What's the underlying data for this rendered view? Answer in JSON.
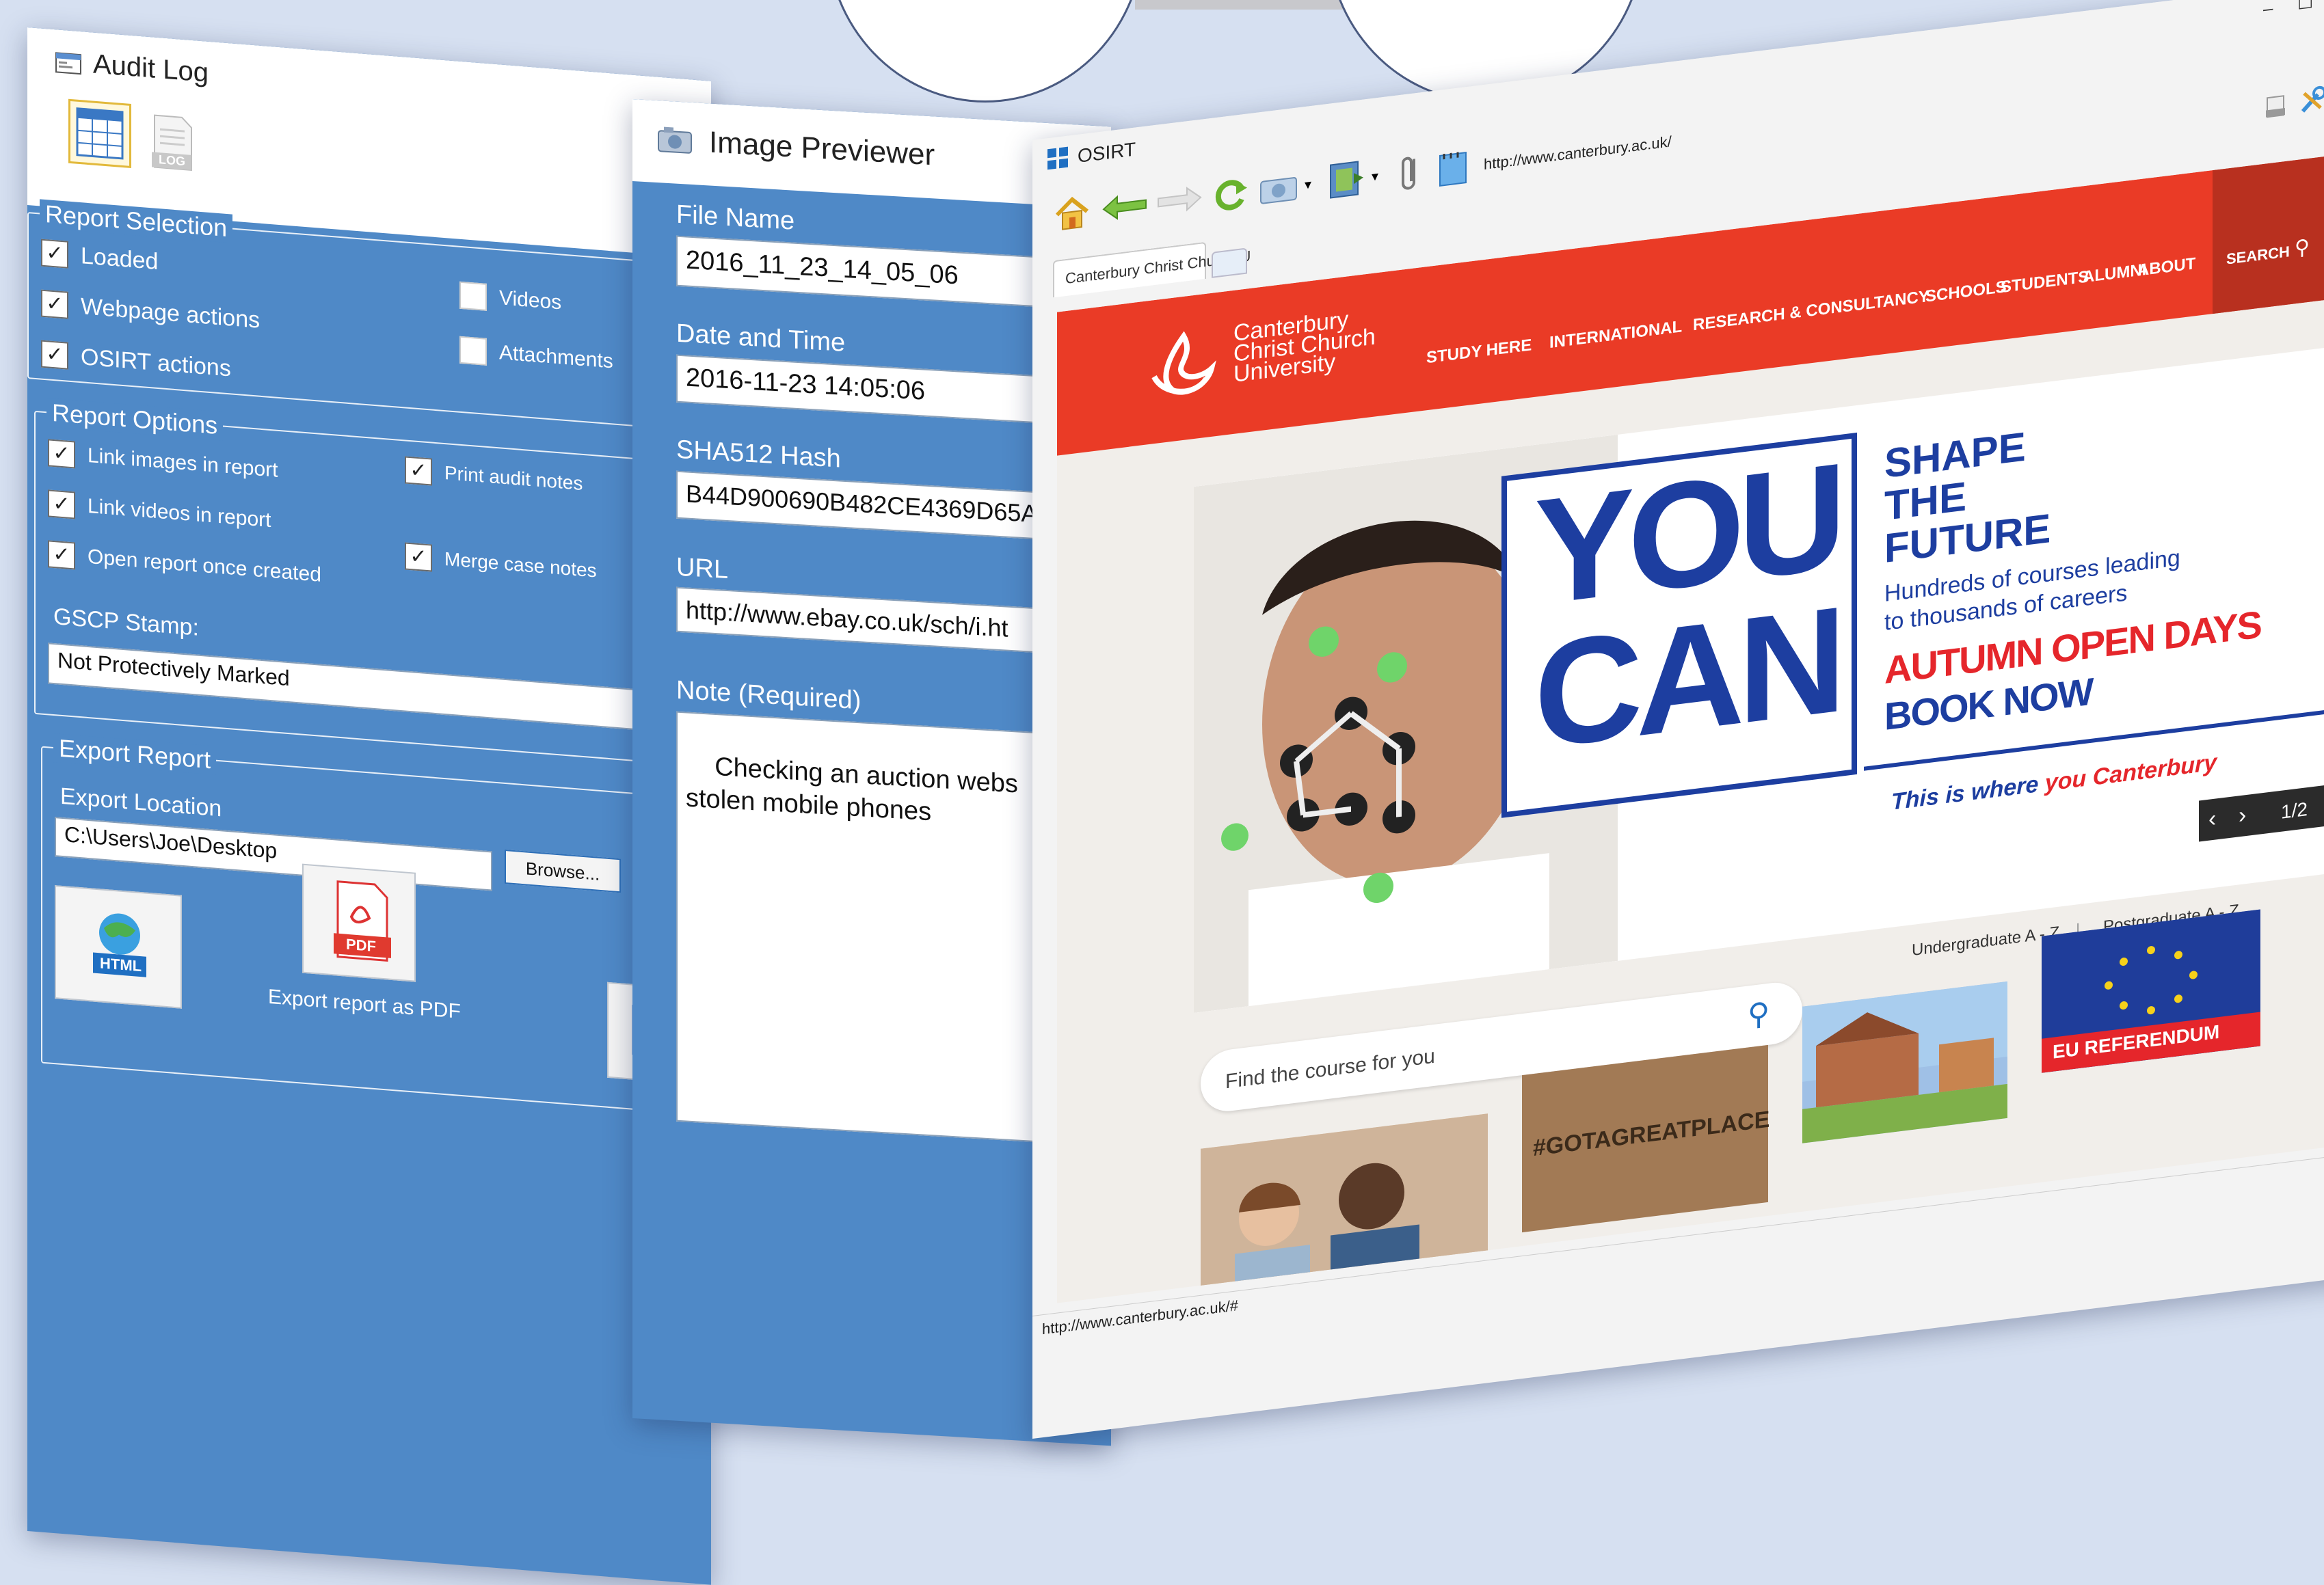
{
  "audit_log": {
    "title": "Audit Log",
    "log_icon_label": "LOG",
    "report_selection": {
      "legend": "Report Selection",
      "items": [
        {
          "label": "Loaded",
          "checked": true
        },
        {
          "label": "Webpage actions",
          "checked": true
        },
        {
          "label": "OSIRT actions",
          "checked": true
        },
        {
          "label": "Videos",
          "checked": false
        },
        {
          "label": "Attachments",
          "checked": false
        }
      ]
    },
    "report_options": {
      "legend": "Report Options",
      "items": [
        {
          "label": "Link images in report",
          "checked": true
        },
        {
          "label": "Link videos in report",
          "checked": true
        },
        {
          "label": "Open report once created",
          "checked": true
        },
        {
          "label": "Print audit notes",
          "checked": true
        },
        {
          "label": "Merge case notes",
          "checked": true
        }
      ],
      "gscp_label": "GSCP Stamp:",
      "gscp_value": "Not Protectively Marked"
    },
    "export_report": {
      "legend": "Export Report",
      "location_label": "Export Location",
      "location_value": "C:\\Users\\Joe\\Desktop",
      "browse_label": "Browse...",
      "html_badge": "HTML",
      "pdf_badge": "PDF",
      "pdf_caption": "Export report as PDF"
    }
  },
  "image_previewer": {
    "title": "Image Previewer",
    "file_name_label": "File Name",
    "file_name_value": "2016_11_23_14_05_06",
    "date_label": "Date and Time",
    "date_value": "2016-11-23 14:05:06",
    "hash_label": "SHA512 Hash",
    "hash_value": "B44D900690B482CE4369D65A",
    "url_label": "URL",
    "url_value": "http://www.ebay.co.uk/sch/i.ht",
    "note_label": "Note (Required)",
    "note_value": "Checking an auction webs\nstolen mobile phones"
  },
  "osirt": {
    "title": "OSIRT",
    "address": "http://www.canterbury.ac.uk/",
    "tab_label": "Canterbury Christ Church U",
    "status_url": "http://www.canterbury.ac.uk/#",
    "log_label": "LOG",
    "site": {
      "logo_lines": [
        "Canterbury",
        "Christ Church",
        "University"
      ],
      "nav": [
        "STUDY HERE",
        "INTERNATIONAL",
        "RESEARCH & CONSULTANCY",
        "SCHOOLS",
        "STUDENTS",
        "ALUMNI",
        "ABOUT"
      ],
      "search_nav": "SEARCH",
      "hero": {
        "you": "YOU",
        "can": "CAN",
        "shape": "SHAPE",
        "the": "THE",
        "future": "FUTURE",
        "sub1": "Hundreds of courses leading",
        "sub2": "to thousands of careers",
        "autumn": "AUTUMN OPEN DAYS",
        "book": "BOOK NOW",
        "tagline_a": "This is where ",
        "tagline_b": "you Canterbury",
        "pager": "1/2"
      },
      "links": [
        "Undergraduate A - Z",
        "Postgraduate A - Z"
      ],
      "links_sep": "|",
      "search_placeholder": "Find the course for you",
      "tiles": [
        "#GOTAGREATPLACE",
        "EU REFERENDUM"
      ]
    }
  },
  "colors": {
    "panel_blue": "#4f89c7",
    "site_red": "#ea3b26",
    "navy": "#1d3ea0",
    "background": "#d6e0f1"
  }
}
